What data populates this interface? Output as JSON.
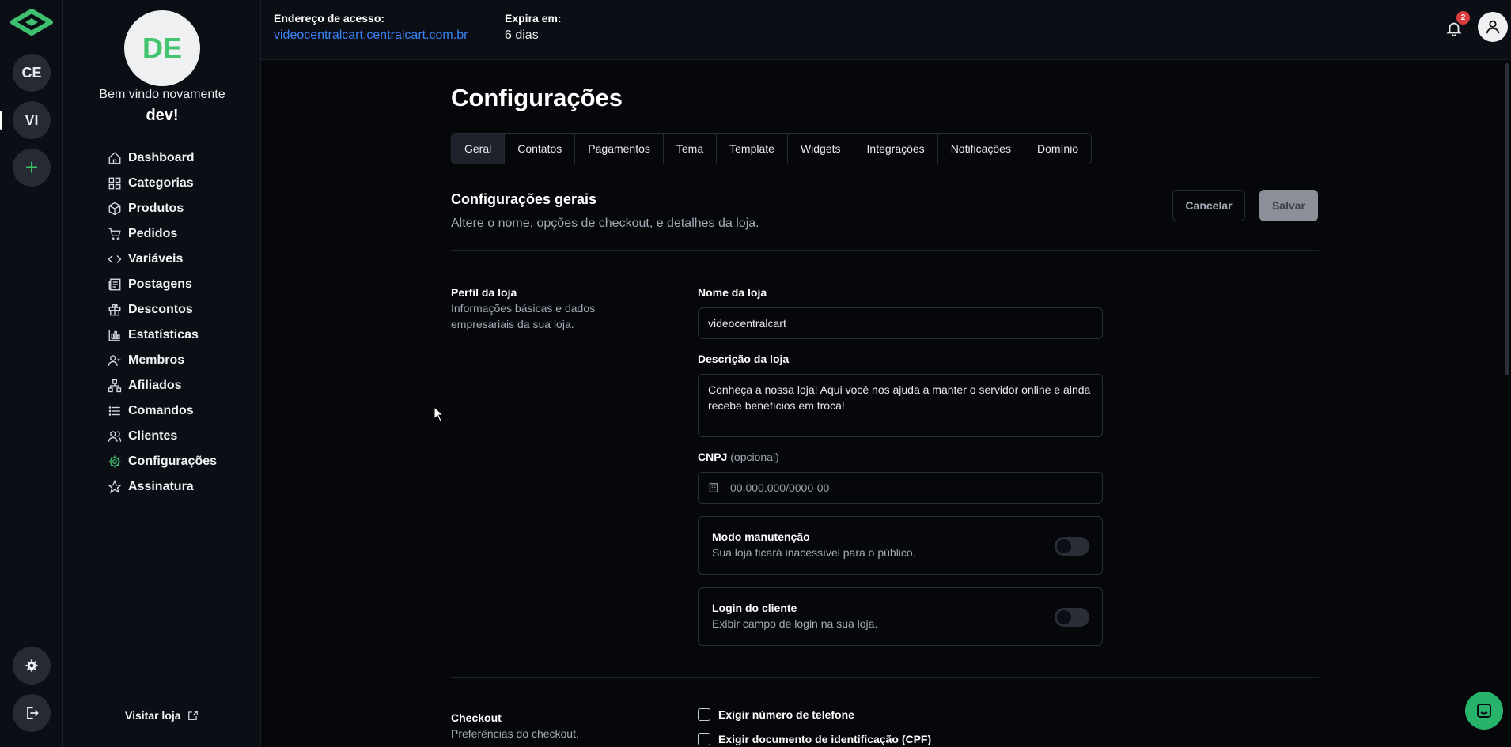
{
  "rail": {
    "stores": [
      {
        "initials": "CE",
        "active": false
      },
      {
        "initials": "VI",
        "active": true
      }
    ],
    "add_label": "+",
    "bottom_icons": [
      "settings-icon",
      "logout-icon"
    ]
  },
  "sidebar": {
    "avatar_initials": "DE",
    "welcome": "Bem vindo novamente",
    "username": "dev!",
    "items": [
      {
        "label": "Dashboard",
        "icon": "home-icon"
      },
      {
        "label": "Categorias",
        "icon": "grid-icon"
      },
      {
        "label": "Produtos",
        "icon": "box-icon"
      },
      {
        "label": "Pedidos",
        "icon": "cart-icon"
      },
      {
        "label": "Variáveis",
        "icon": "code-icon"
      },
      {
        "label": "Postagens",
        "icon": "newspaper-icon"
      },
      {
        "label": "Descontos",
        "icon": "gift-icon"
      },
      {
        "label": "Estatísticas",
        "icon": "chart-icon"
      },
      {
        "label": "Membros",
        "icon": "user-plus-icon"
      },
      {
        "label": "Afiliados",
        "icon": "network-icon"
      },
      {
        "label": "Comandos",
        "icon": "list-icon"
      },
      {
        "label": "Clientes",
        "icon": "users-icon"
      },
      {
        "label": "Configurações",
        "icon": "gear-icon",
        "active": true
      },
      {
        "label": "Assinatura",
        "icon": "star-icon"
      }
    ],
    "visit_label": "Visitar loja"
  },
  "topbar": {
    "access_label": "Endereço de acesso:",
    "access_url": "videocentralcart.centralcart.com.br",
    "expires_label": "Expira em:",
    "expires_value": "6 dias",
    "notification_count": "2"
  },
  "main": {
    "title": "Configurações",
    "tabs": [
      {
        "label": "Geral",
        "active": true
      },
      {
        "label": "Contatos"
      },
      {
        "label": "Pagamentos"
      },
      {
        "label": "Tema"
      },
      {
        "label": "Template"
      },
      {
        "label": "Widgets"
      },
      {
        "label": "Integrações"
      },
      {
        "label": "Notificações"
      },
      {
        "label": "Domínio"
      }
    ],
    "section_title": "Configurações gerais",
    "section_subtitle": "Altere o nome, opções de checkout, e detalhes da loja.",
    "cancel_label": "Cancelar",
    "save_label": "Salvar",
    "profile": {
      "title": "Perfil da loja",
      "description": "Informações básicas e dados empresariais da sua loja.",
      "name_label": "Nome da loja",
      "name_value": "videocentralcart",
      "desc_label": "Descrição da loja",
      "desc_value": "Conheça a nossa loja! Aqui você nos ajuda a manter o servidor online e ainda recebe benefícios em troca!",
      "cnpj_label": "CNPJ",
      "cnpj_optional": "(opcional)",
      "cnpj_placeholder": "00.000.000/0000-00",
      "maintenance_title": "Modo manutenção",
      "maintenance_desc": "Sua loja ficará inacessível para o público.",
      "maintenance_on": false,
      "login_title": "Login do cliente",
      "login_desc": "Exibir campo de login na sua loja.",
      "login_on": false
    },
    "checkout": {
      "title": "Checkout",
      "description": "Preferências do checkout.",
      "options": [
        {
          "label": "Exigir número de telefone",
          "checked": false
        },
        {
          "label": "Exigir documento de identificação (CPF)",
          "checked": false
        }
      ]
    }
  },
  "colors": {
    "accent": "#3fbf70",
    "link": "#3b82f6",
    "badge": "#dc3c3c",
    "background": "#05070b"
  }
}
